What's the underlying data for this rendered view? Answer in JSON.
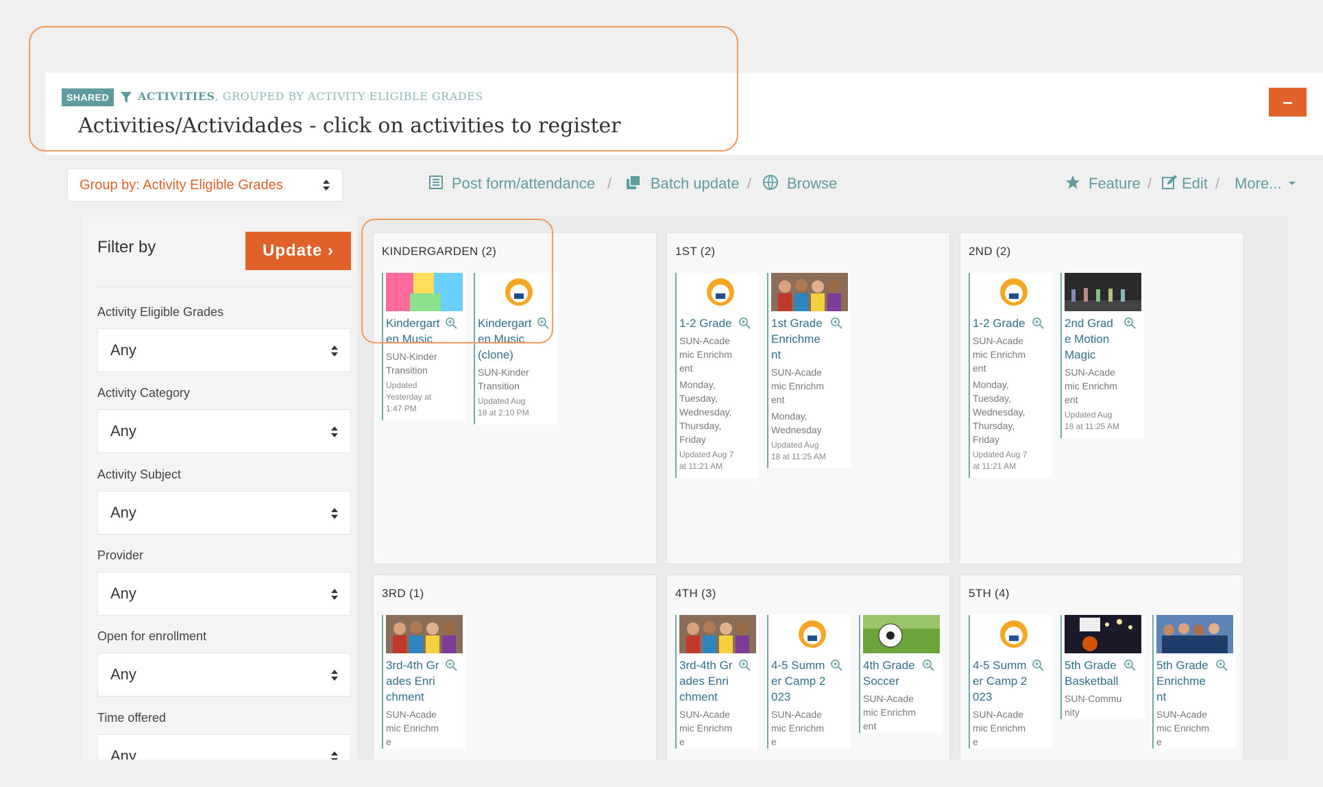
{
  "header": {
    "badge": "SHARED",
    "crumb_strong": "ACTIVITIES",
    "crumb_rest": ", GROUPED BY ACTIVITY ELIGIBLE GRADES",
    "title": "Activities/Actividades - click on activities to register",
    "collapse_label": "–"
  },
  "toolbar": {
    "group_by": "Group by: Activity Eligible Grades",
    "post_form": "Post form/attendance",
    "batch_update": "Batch update",
    "browse": "Browse",
    "feature": "Feature",
    "edit": "Edit",
    "more": "More...",
    "sep": "/"
  },
  "filters": {
    "title": "Filter by",
    "update_label": "Update ›",
    "fields": [
      {
        "label": "Activity Eligible Grades",
        "value": "Any"
      },
      {
        "label": "Activity Category",
        "value": "Any"
      },
      {
        "label": "Activity Subject",
        "value": "Any"
      },
      {
        "label": "Provider",
        "value": "Any"
      },
      {
        "label": "Open for enrollment",
        "value": "Any"
      },
      {
        "label": "Time offered",
        "value": "Any"
      }
    ]
  },
  "groups": [
    {
      "title": "KINDERGARDEN (2)",
      "cards": [
        {
          "thumb": "music-image",
          "name": "Kindergarten Music",
          "category": "SUN-Kinder Transition",
          "days": "",
          "updated": "Updated Yesterday at 1:47 PM"
        },
        {
          "thumb": "logo-image",
          "name": "Kindergarten Music (clone)",
          "category": "SUN-Kinder Transition",
          "days": "",
          "updated": "Updated Aug 18 at 2:10 PM"
        }
      ]
    },
    {
      "title": "1ST (2)",
      "cards": [
        {
          "thumb": "logo-image",
          "name": "1-2 Grade",
          "category": "SUN-Academic Enrichment",
          "days": "Monday, Tuesday, Wednesday, Thursday, Friday",
          "updated": "Updated Aug 7 at 11:21 AM"
        },
        {
          "thumb": "kids-photo",
          "name": "1st Grade Enrichment",
          "category": "SUN-Academic Enrichment",
          "days": "Monday, Wednesday",
          "updated": "Updated Aug 18 at 11:25 AM"
        }
      ]
    },
    {
      "title": "2ND (2)",
      "cards": [
        {
          "thumb": "logo-image",
          "name": "1-2 Grade",
          "category": "SUN-Academic Enrichment",
          "days": "Monday, Tuesday, Wednesday, Thursday, Friday",
          "updated": "Updated Aug 7 at 11:21 AM"
        },
        {
          "thumb": "stage-photo",
          "name": "2nd Grade Motion Magic",
          "category": "SUN-Academic Enrichment",
          "days": "",
          "updated": "Updated Aug 18 at 11:25 AM"
        }
      ]
    },
    {
      "title": "3RD (1)",
      "cards": [
        {
          "thumb": "kids-photo",
          "name": "3rd-4th Grades Enrichment",
          "category": "SUN-Academic Enrichme",
          "days": "",
          "updated": ""
        }
      ]
    },
    {
      "title": "4TH (3)",
      "cards": [
        {
          "thumb": "kids-photo",
          "name": "3rd-4th Grades Enrichment",
          "category": "SUN-Academic Enrichme",
          "days": "",
          "updated": ""
        },
        {
          "thumb": "logo-image",
          "name": "4-5 Summer Camp 2023",
          "category": "SUN-Academic Enrichme",
          "days": "",
          "updated": ""
        },
        {
          "thumb": "soccer-photo",
          "name": "4th Grade Soccer",
          "category": "SUN-Academic Enrichment",
          "days": "",
          "updated": ""
        }
      ]
    },
    {
      "title": "5TH (4)",
      "cards": [
        {
          "thumb": "logo-image",
          "name": "4-5 Summer Camp 2023",
          "category": "SUN-Academic Enrichme",
          "days": "",
          "updated": ""
        },
        {
          "thumb": "basketball-photo",
          "name": "5th Grade Basketball",
          "category": "SUN-Community",
          "days": "",
          "updated": ""
        },
        {
          "thumb": "group-photo",
          "name": "5th Grade Enrichment",
          "category": "SUN-Academic Enrichme",
          "days": "",
          "updated": ""
        }
      ]
    }
  ],
  "colors": {
    "accent": "#e0622a",
    "teal": "#5e9c9f",
    "link": "#2f6f89"
  }
}
